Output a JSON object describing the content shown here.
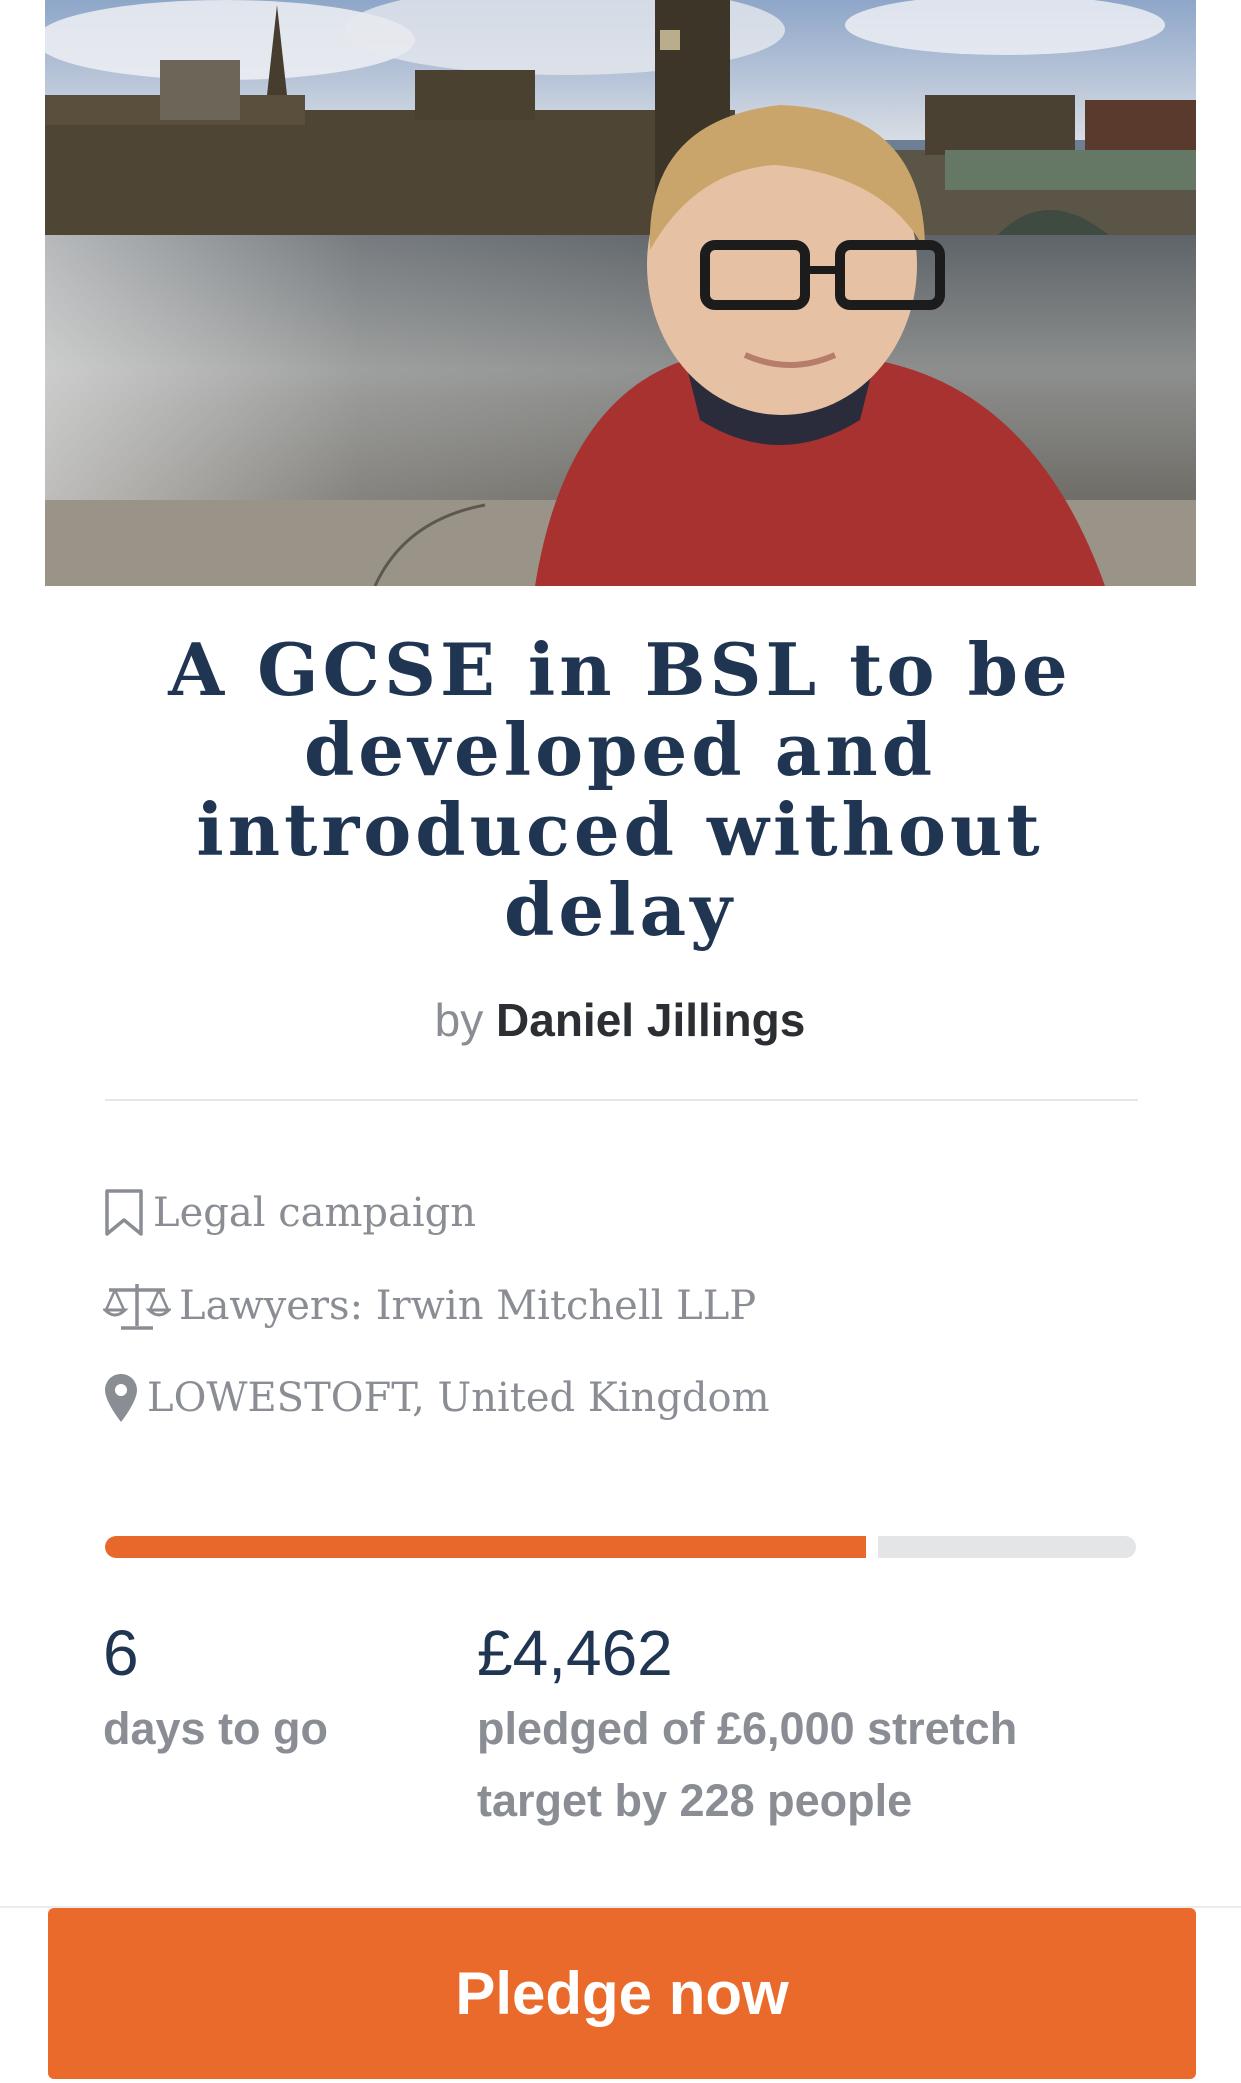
{
  "hero": {
    "image_label": "campaign-photo-westminster"
  },
  "campaign": {
    "title": "A GCSE in BSL to be developed and introduced without delay",
    "by_prefix": "by",
    "author": "Daniel Jillings",
    "type": "Legal campaign",
    "lawyers": "Lawyers: Irwin Mitchell LLP",
    "location": "LOWESTOFT, United Kingdom"
  },
  "icons": {
    "type": "bookmark-icon",
    "lawyers": "scales-icon",
    "location": "map-pin-icon"
  },
  "progress": {
    "fraction": 0.7437,
    "fill_color": "#e8682c",
    "track_color": "#e4e5e6"
  },
  "stats": {
    "days_value": "6",
    "days_label": "days to go",
    "amount_value": "£4,462",
    "amount_label": "pledged of £6,000 stretch target by 228 people"
  },
  "cta": {
    "label": "Pledge now",
    "color": "#ea6a2c"
  },
  "colors": {
    "title": "#1f3552",
    "muted": "#8a8e94"
  }
}
